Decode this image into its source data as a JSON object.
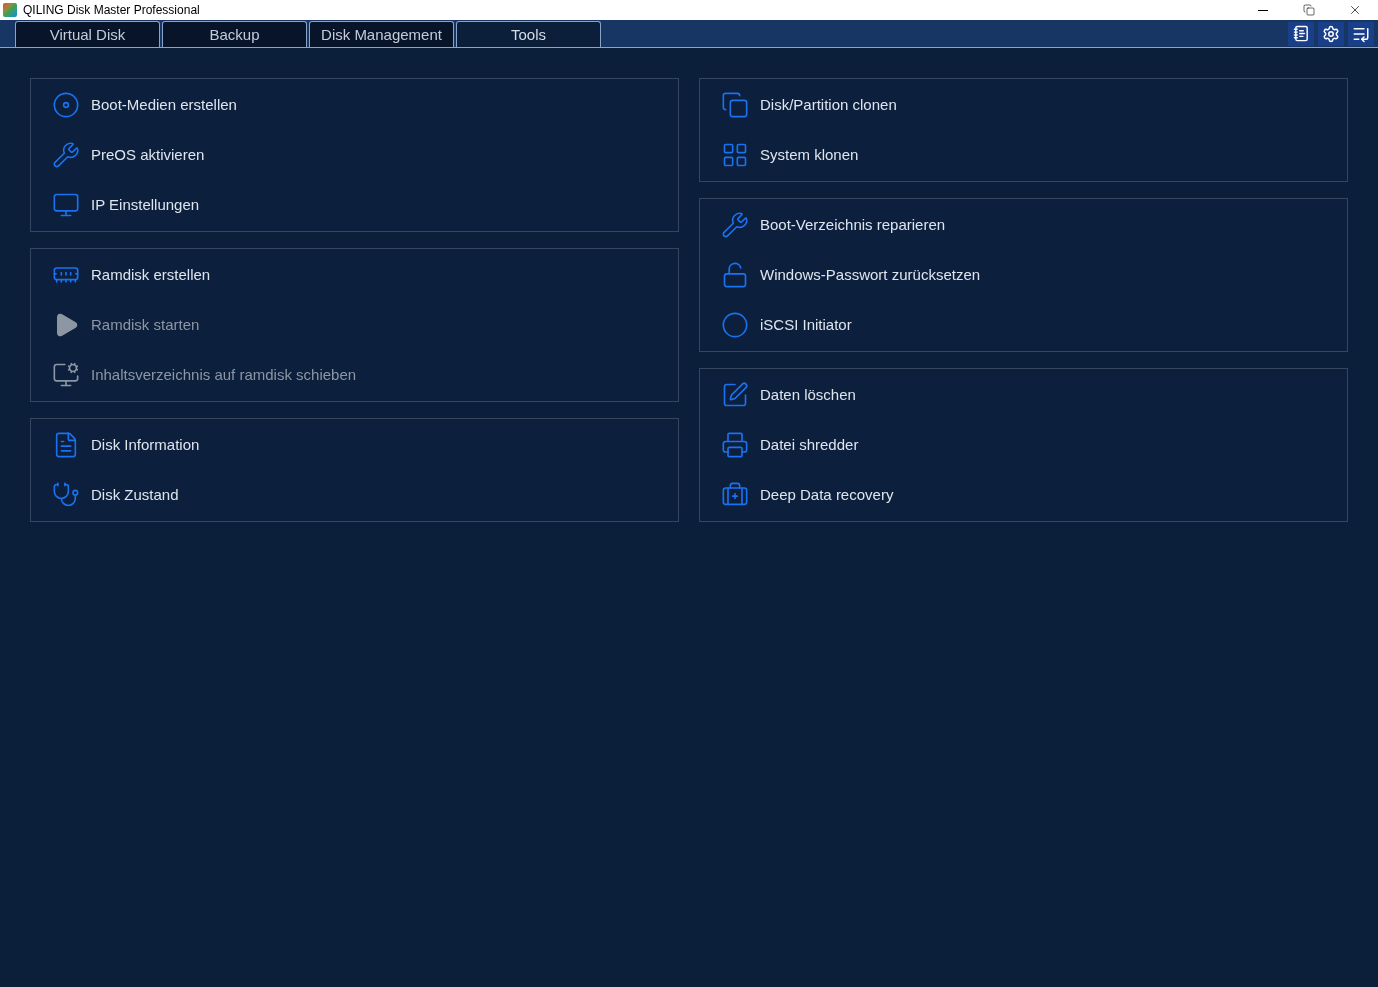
{
  "window": {
    "title": "QILING Disk Master Professional"
  },
  "tabs": [
    {
      "label": "Virtual Disk",
      "selected": false
    },
    {
      "label": "Backup",
      "selected": false
    },
    {
      "label": "Disk Management",
      "selected": false
    },
    {
      "label": "Tools",
      "selected": true
    }
  ],
  "columns": [
    [
      {
        "items": [
          {
            "label": "Boot-Medien erstellen",
            "disabled": false
          },
          {
            "label": "PreOS aktivieren",
            "disabled": false
          },
          {
            "label": "IP Einstellungen",
            "disabled": false
          }
        ]
      },
      {
        "items": [
          {
            "label": "Ramdisk erstellen",
            "disabled": false
          },
          {
            "label": "Ramdisk starten",
            "disabled": true
          },
          {
            "label": "Inhaltsverzeichnis auf ramdisk schieben",
            "disabled": true
          }
        ]
      },
      {
        "items": [
          {
            "label": "Disk Information",
            "disabled": false
          },
          {
            "label": "Disk Zustand",
            "disabled": false
          }
        ]
      }
    ],
    [
      {
        "items": [
          {
            "label": "Disk/Partition clonen",
            "disabled": false
          },
          {
            "label": "System klonen",
            "disabled": false
          }
        ]
      },
      {
        "items": [
          {
            "label": "Boot-Verzeichnis reparieren",
            "disabled": false
          },
          {
            "label": "Windows-Passwort zurücksetzen",
            "disabled": false
          },
          {
            "label": "iSCSI Initiator",
            "disabled": false
          }
        ]
      },
      {
        "items": [
          {
            "label": "Daten löschen",
            "disabled": false
          },
          {
            "label": "Datei shredder",
            "disabled": false
          },
          {
            "label": "Deep Data recovery",
            "disabled": false
          }
        ]
      }
    ]
  ]
}
